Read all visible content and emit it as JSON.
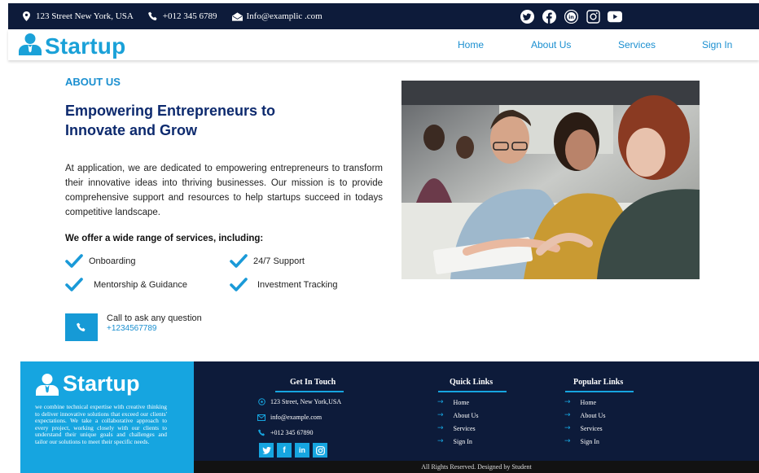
{
  "topbar": {
    "address": "123 Street New York, USA",
    "phone": "+012 345 6789",
    "email": "Info@examplic .com",
    "socials": [
      "twitter-icon",
      "facebook-icon",
      "linkedin-icon",
      "instagram-icon",
      "youtube-icon"
    ]
  },
  "header": {
    "brand": "Startup",
    "nav": [
      "Home",
      "About Us",
      "Services",
      "Sign In"
    ]
  },
  "about": {
    "kicker": "ABOUT US",
    "headline": "Empowering Entrepreneurs to Innovate and Grow",
    "paragraph": "At application, we are dedicated to empowering entrepreneurs to transform their innovative ideas into thriving businesses. Our mission is to provide comprehensive support and resources to help startups succeed in todays competitive landscape.",
    "offer_title": "We offer a wide range of services, including:",
    "services": [
      "Onboarding",
      "24/7 Support",
      "Mentorship & Guidance",
      "Investment Tracking"
    ],
    "call_label": "Call to ask any question",
    "call_number": "+1234567789"
  },
  "footer": {
    "brand": "Startup",
    "description": "we combine technical expertise with creative thinking to deliver innovative solutions that exceed our clients' expectations. We take a collaborative approach to every project, working closely with our clients to understand their unique goals and challenges and tailor our solutions to meet their specific needs.",
    "contact_title": "Get In Touch",
    "contact": {
      "address": "123 Street, New York,USA",
      "email": "info@example.com",
      "phone": "+012 345 67890"
    },
    "socials": [
      "f",
      "in"
    ],
    "quick_title": "Quick Links",
    "quick_links": [
      "Home",
      "About Us",
      "Services",
      "Sign In"
    ],
    "popular_title": "Popular Links",
    "popular_links": [
      "Home",
      "About Us",
      "Services",
      "Sign In"
    ],
    "copyright": "All Rights Reserved. Designed by Student"
  },
  "colors": {
    "navy": "#0d1b3a",
    "accent": "#16a5e0",
    "heading": "#0d2a6e"
  }
}
